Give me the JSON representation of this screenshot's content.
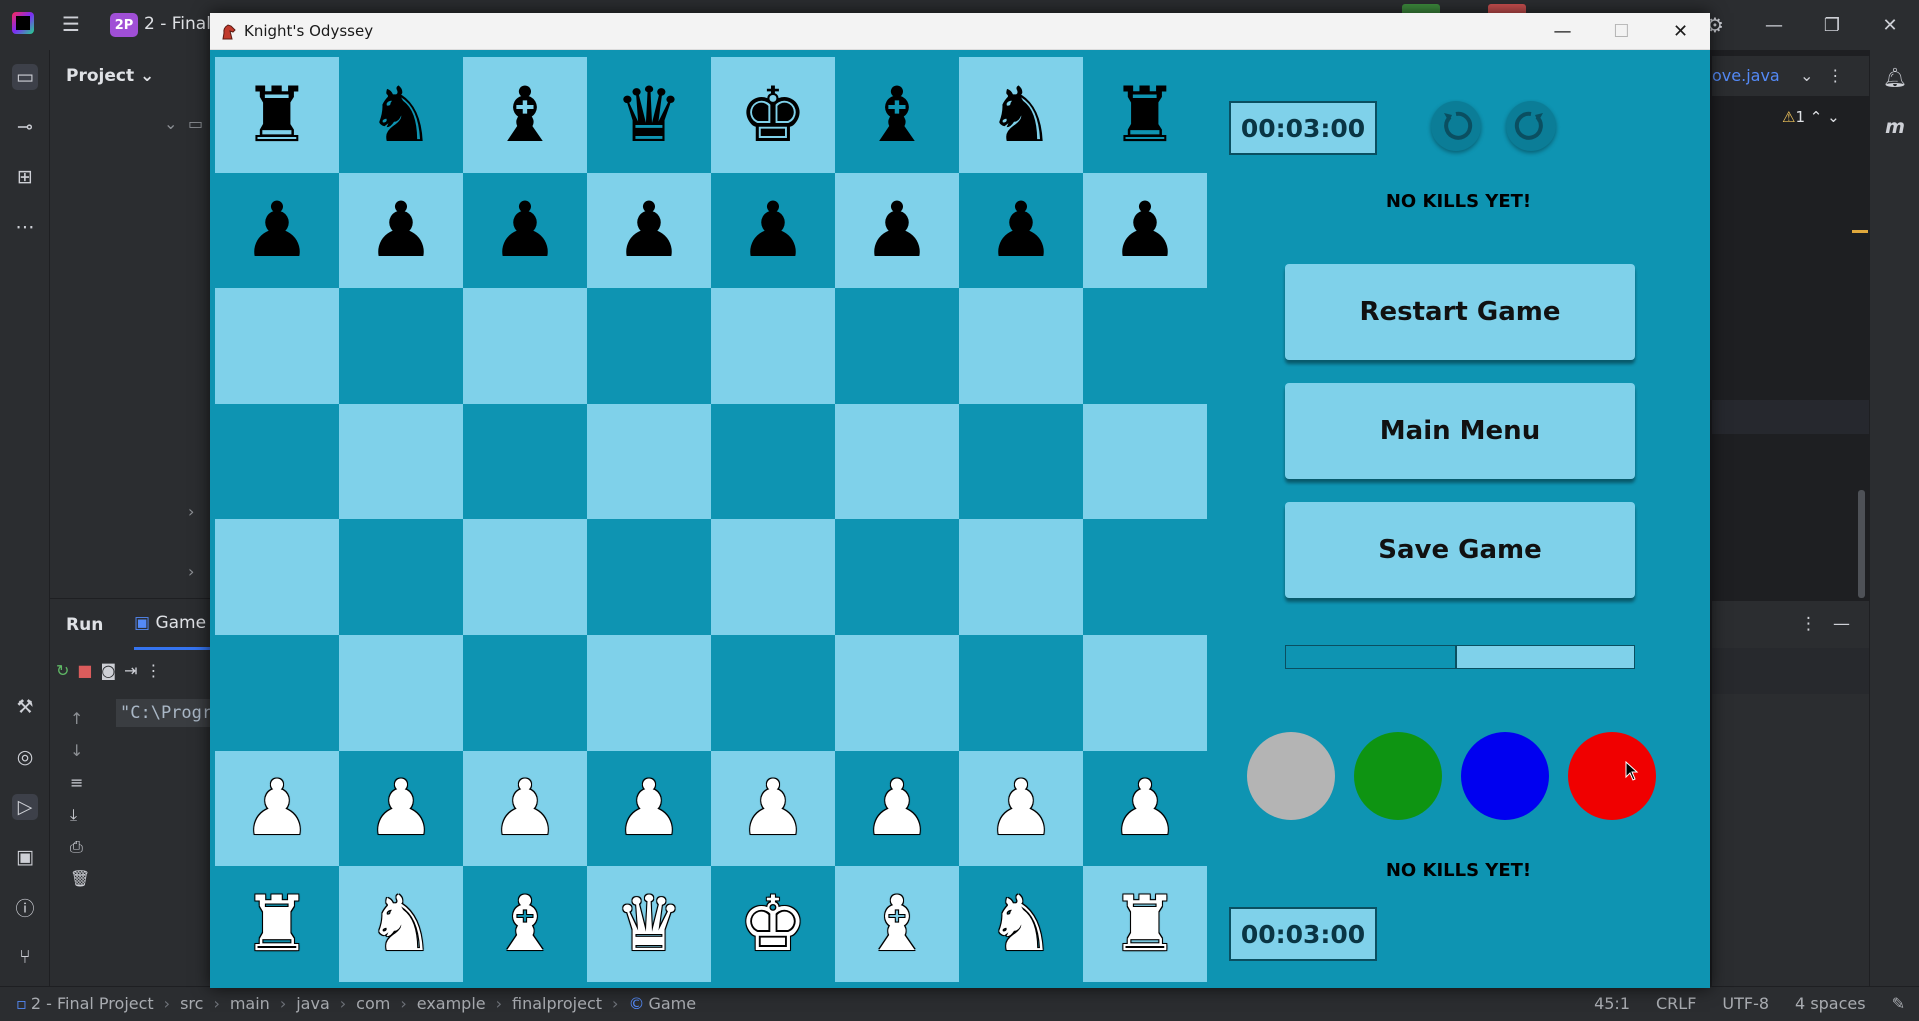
{
  "ide": {
    "project_badge": "2P",
    "project_name": "2 - Final",
    "project_label": "Project ⌄",
    "run_label": "Run",
    "game_tab": "Game",
    "console_text": "\"C:\\Progr",
    "right_tab": "ove.java",
    "warning_count": "1",
    "breadcrumb": [
      "2 - Final Project",
      "src",
      "main",
      "java",
      "com",
      "example",
      "finalproject",
      "Game"
    ],
    "status": {
      "position": "45:1",
      "line_sep": "CRLF",
      "encoding": "UTF-8",
      "indent": "4 spaces"
    }
  },
  "window": {
    "title": "Knight's Odyssey",
    "minimize": "—",
    "maximize": "☐",
    "close": "✕"
  },
  "board": {
    "rows": [
      [
        {
          "glyph": "♜",
          "color": "black"
        },
        {
          "glyph": "♞",
          "color": "black"
        },
        {
          "glyph": "♝",
          "color": "black"
        },
        {
          "glyph": "♛",
          "color": "black"
        },
        {
          "glyph": "♚",
          "color": "black"
        },
        {
          "glyph": "♝",
          "color": "black"
        },
        {
          "glyph": "♞",
          "color": "black"
        },
        {
          "glyph": "♜",
          "color": "black"
        }
      ],
      [
        {
          "glyph": "♟",
          "color": "black"
        },
        {
          "glyph": "♟",
          "color": "black"
        },
        {
          "glyph": "♟",
          "color": "black"
        },
        {
          "glyph": "♟",
          "color": "black"
        },
        {
          "glyph": "♟",
          "color": "black"
        },
        {
          "glyph": "♟",
          "color": "black"
        },
        {
          "glyph": "♟",
          "color": "black"
        },
        {
          "glyph": "♟",
          "color": "black"
        }
      ],
      [
        null,
        null,
        null,
        null,
        null,
        null,
        null,
        null
      ],
      [
        null,
        null,
        null,
        null,
        null,
        null,
        null,
        null
      ],
      [
        null,
        null,
        null,
        null,
        null,
        null,
        null,
        null
      ],
      [
        null,
        null,
        null,
        null,
        null,
        null,
        null,
        null
      ],
      [
        {
          "glyph": "♟",
          "color": "white"
        },
        {
          "glyph": "♟",
          "color": "white"
        },
        {
          "glyph": "♟",
          "color": "white"
        },
        {
          "glyph": "♟",
          "color": "white"
        },
        {
          "glyph": "♟",
          "color": "white"
        },
        {
          "glyph": "♟",
          "color": "white"
        },
        {
          "glyph": "♟",
          "color": "white"
        },
        {
          "glyph": "♟",
          "color": "white"
        }
      ],
      [
        {
          "glyph": "♜",
          "color": "white"
        },
        {
          "glyph": "♞",
          "color": "white"
        },
        {
          "glyph": "♝",
          "color": "white"
        },
        {
          "glyph": "♛",
          "color": "white"
        },
        {
          "glyph": "♚",
          "color": "white"
        },
        {
          "glyph": "♝",
          "color": "white"
        },
        {
          "glyph": "♞",
          "color": "white"
        },
        {
          "glyph": "♜",
          "color": "white"
        }
      ]
    ],
    "light_color": "#7fd1ea",
    "dark_color": "#0e94b2"
  },
  "sidebar": {
    "top_timer": "00:03:00",
    "bottom_timer": "00:03:00",
    "top_kills": "NO KILLS YET!",
    "bottom_kills": "NO KILLS YET!",
    "undo_icon": "undo-icon",
    "redo_icon": "redo-icon",
    "restart_label": "Restart Game",
    "main_menu_label": "Main Menu",
    "save_label": "Save Game",
    "progress_fraction": 0.49,
    "theme_colors": [
      "#b4b4b4",
      "#0e9412",
      "#0000f0",
      "#f00000"
    ]
  }
}
